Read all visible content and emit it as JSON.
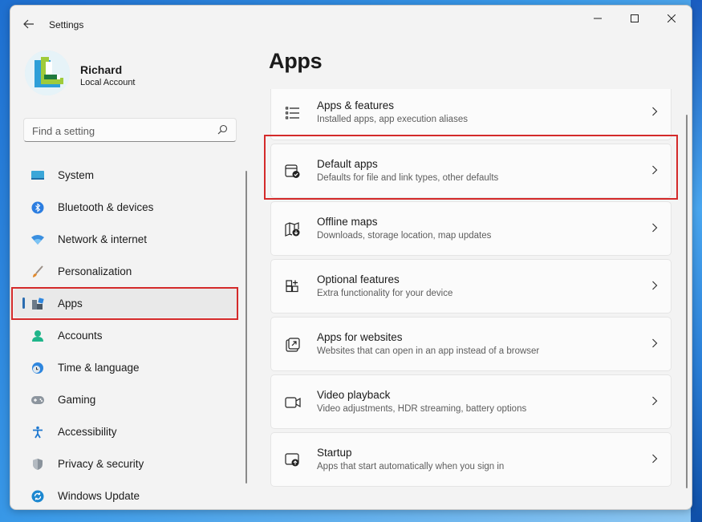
{
  "window": {
    "title": "Settings"
  },
  "user": {
    "name": "Richard",
    "account_type": "Local Account"
  },
  "search": {
    "placeholder": "Find a setting"
  },
  "sidebar": {
    "items": [
      {
        "label": "System",
        "icon": "monitor-icon"
      },
      {
        "label": "Bluetooth & devices",
        "icon": "bluetooth-icon"
      },
      {
        "label": "Network & internet",
        "icon": "wifi-icon"
      },
      {
        "label": "Personalization",
        "icon": "brush-icon"
      },
      {
        "label": "Apps",
        "icon": "apps-icon",
        "selected": true
      },
      {
        "label": "Accounts",
        "icon": "person-icon"
      },
      {
        "label": "Time & language",
        "icon": "globe-clock-icon"
      },
      {
        "label": "Gaming",
        "icon": "gamepad-icon"
      },
      {
        "label": "Accessibility",
        "icon": "accessibility-icon"
      },
      {
        "label": "Privacy & security",
        "icon": "shield-icon"
      },
      {
        "label": "Windows Update",
        "icon": "update-icon"
      }
    ]
  },
  "main": {
    "title": "Apps",
    "cards": [
      {
        "title": "Apps & features",
        "subtitle": "Installed apps, app execution aliases",
        "icon": "list-icon"
      },
      {
        "title": "Default apps",
        "subtitle": "Defaults for file and link types, other defaults",
        "icon": "default-apps-icon"
      },
      {
        "title": "Offline maps",
        "subtitle": "Downloads, storage location, map updates",
        "icon": "map-download-icon"
      },
      {
        "title": "Optional features",
        "subtitle": "Extra functionality for your device",
        "icon": "grid-plus-icon"
      },
      {
        "title": "Apps for websites",
        "subtitle": "Websites that can open in an app instead of a browser",
        "icon": "open-external-icon"
      },
      {
        "title": "Video playback",
        "subtitle": "Video adjustments, HDR streaming, battery options",
        "icon": "video-icon"
      },
      {
        "title": "Startup",
        "subtitle": "Apps that start automatically when you sign in",
        "icon": "startup-icon"
      }
    ]
  },
  "colors": {
    "accent": "#2b6cb0",
    "highlight": "#d42a2a"
  }
}
